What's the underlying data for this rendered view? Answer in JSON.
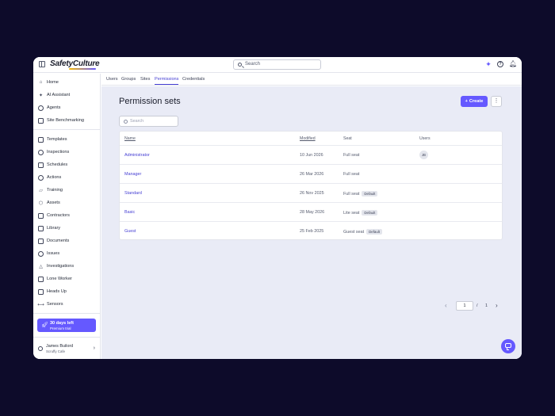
{
  "header": {
    "logo_text": "SafetyCulture",
    "search_placeholder": "Search",
    "icons": [
      "sidebar-toggle-icon",
      "sparkle-icon",
      "help-icon",
      "bell-icon"
    ]
  },
  "sidebar": {
    "items": [
      {
        "label": "Home",
        "icon": "home-icon"
      },
      {
        "label": "AI Assistant",
        "icon": "sparkle-icon"
      },
      {
        "label": "Agents",
        "icon": "agents-icon"
      },
      {
        "label": "Site Benchmarking",
        "icon": "benchmark-icon"
      },
      {
        "label": "Templates",
        "icon": "templates-icon"
      },
      {
        "label": "Inspections",
        "icon": "inspections-icon"
      },
      {
        "label": "Schedules",
        "icon": "schedules-icon"
      },
      {
        "label": "Actions",
        "icon": "actions-icon"
      },
      {
        "label": "Training",
        "icon": "training-icon"
      },
      {
        "label": "Assets",
        "icon": "assets-icon"
      },
      {
        "label": "Contractors",
        "icon": "contractors-icon"
      },
      {
        "label": "Library",
        "icon": "library-icon"
      },
      {
        "label": "Documents",
        "icon": "documents-icon"
      },
      {
        "label": "Issues",
        "icon": "issues-icon"
      },
      {
        "label": "Investigations",
        "icon": "investigations-icon"
      },
      {
        "label": "Lone Worker",
        "icon": "lone-worker-icon"
      },
      {
        "label": "Heads Up",
        "icon": "heads-up-icon"
      },
      {
        "label": "Sensors",
        "icon": "sensors-icon"
      }
    ],
    "trial": {
      "title": "30 days left",
      "subtitle": "Premium trial"
    },
    "user": {
      "name": "James Builord",
      "org": "Scruffy Cafe"
    }
  },
  "tabs": [
    {
      "label": "Users",
      "active": false
    },
    {
      "label": "Groups",
      "active": false
    },
    {
      "label": "Sites",
      "active": false
    },
    {
      "label": "Permissions",
      "active": true
    },
    {
      "label": "Credentials",
      "active": false
    }
  ],
  "main": {
    "title": "Permission sets",
    "create_label": "Create",
    "more_label": "⋮",
    "search_placeholder": "Search"
  },
  "table": {
    "headers": {
      "name": "Name",
      "modified": "Modified",
      "seat": "Seat",
      "users": "Users"
    },
    "rows": [
      {
        "name": "Administrator",
        "modified": "10 Jun 2026",
        "seat": "Full seat",
        "badge": "",
        "users": "JB"
      },
      {
        "name": "Manager",
        "modified": "26 Mar 2026",
        "seat": "Full seat",
        "badge": "",
        "users": ""
      },
      {
        "name": "Standard",
        "modified": "26 Nov 2025",
        "seat": "Full seat",
        "badge": "Default",
        "users": ""
      },
      {
        "name": "Basic",
        "modified": "28 May 2026",
        "seat": "Lite seat",
        "badge": "Default",
        "users": ""
      },
      {
        "name": "Guest",
        "modified": "25 Feb 2025",
        "seat": "Guest seat",
        "badge": "Default",
        "users": ""
      }
    ]
  },
  "pagination": {
    "current": "1",
    "separator": "/",
    "total": "1"
  },
  "colors": {
    "accent": "#6559ff",
    "link": "#4740d4",
    "background": "#0d0b2a",
    "content_bg": "#e9ebf6"
  }
}
